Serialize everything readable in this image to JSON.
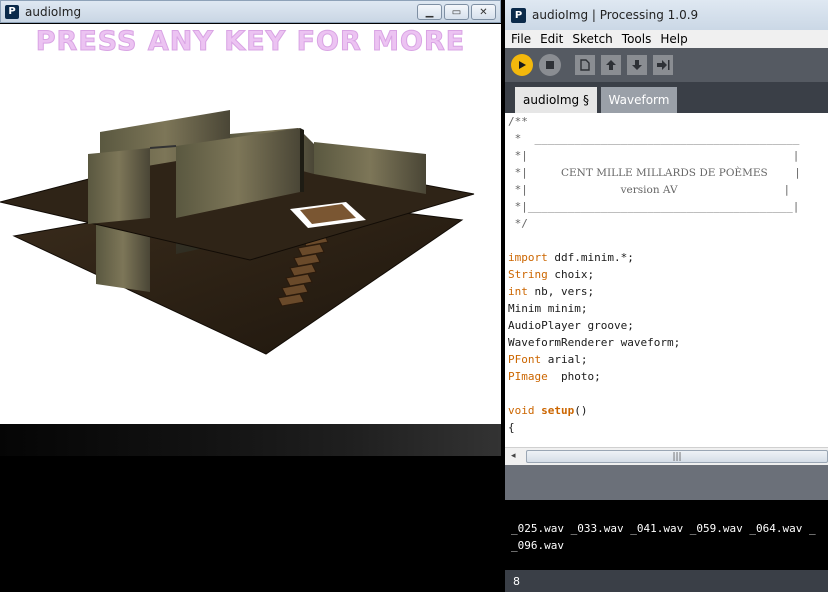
{
  "sketch_window": {
    "icon": "P",
    "title": "audioImg",
    "controls": {
      "minimize": "minimize-icon",
      "maximize": "maximize-icon",
      "close": "close-icon"
    },
    "banner": "PRESS ANY KEY FOR MORE",
    "banner_color": "#ecc3f2"
  },
  "ide": {
    "icon": "P",
    "title": "audioImg | Processing 1.0.9",
    "menu": [
      "File",
      "Edit",
      "Sketch",
      "Tools",
      "Help"
    ],
    "toolbar": {
      "run": "play-icon",
      "stop": "stop-icon",
      "new": "new-file-icon",
      "open": "open-icon",
      "save": "save-icon",
      "export": "export-icon",
      "accent": "#f3b80c"
    },
    "tabs": [
      "audioImg §",
      "Waveform"
    ],
    "code": {
      "comment_open": "/**",
      "rule_top": " *  ________________________________________",
      "bar_empty": " *|                                        |",
      "title_prefix": " *|     ",
      "poem_title": "CENT MILLE MILLARDS DE POÈMES",
      "title_suffix": "    |",
      "version_prefix": " *|              ",
      "version_text": "version AV",
      "version_suffix": "                |",
      "rule_bottom": " *|________________________________________|",
      "comment_close": " */",
      "import_kw": "import",
      "import_rest": " ddf.minim.*;",
      "string_kw": "String",
      "string_rest": " choix;",
      "int_kw": "int",
      "int_rest": " nb, vers;",
      "minim_line": "Minim minim;",
      "player_line": "AudioPlayer groove;",
      "renderer_line": "WaveformRenderer waveform;",
      "pfont_kw": "PFont",
      "pfont_rest": " arial;",
      "pimage_kw": "PImage",
      "pimage_rest": "  photo;",
      "void_kw": "void",
      "setup_fn": "setup",
      "setup_rest": "()",
      "brace": "{"
    },
    "scrollbar": {
      "left_arrow": "◂",
      "grip": "|||"
    },
    "console": {
      "line1": "_025.wav _033.wav _041.wav _059.wav _064.wav _",
      "line2": "_096.wav"
    },
    "line_number": "8"
  }
}
